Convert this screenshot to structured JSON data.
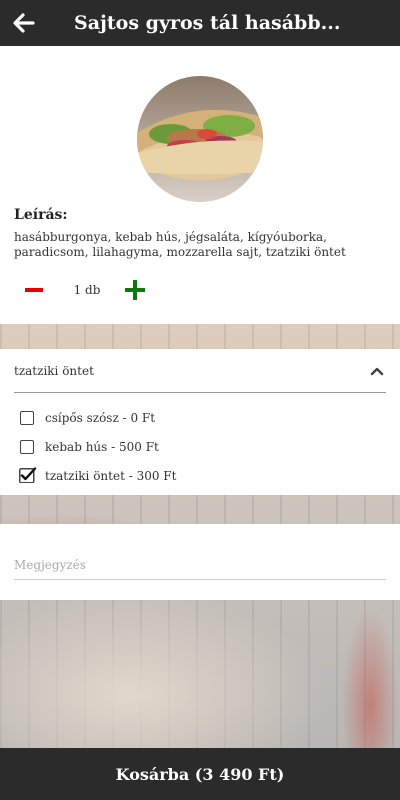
{
  "header": {
    "title": "Sajtos gyros tál hasább..."
  },
  "product": {
    "image_icon": "gyros-food-photo",
    "description_label": "Leírás:",
    "description": "hasábburgonya, kebab hús, jégsaláta, kígyóuborka, paradicsom, lilahagyma, mozzarella sajt, tzatziki öntet",
    "quantity": "1 db"
  },
  "options": {
    "header_label": "tzatziki öntet",
    "items": [
      {
        "label": "csípős szósz - 0 Ft",
        "checked": false
      },
      {
        "label": "kebab hús - 500 Ft",
        "checked": false
      },
      {
        "label": "tzatziki öntet - 300 Ft",
        "checked": true
      }
    ]
  },
  "note": {
    "placeholder": "Megjegyzés",
    "value": ""
  },
  "cart": {
    "label": "Kosárba (3 490 Ft)"
  },
  "colors": {
    "bar": "#2b2b2b",
    "minus": "#e60000",
    "plus": "#0b7a0b"
  }
}
